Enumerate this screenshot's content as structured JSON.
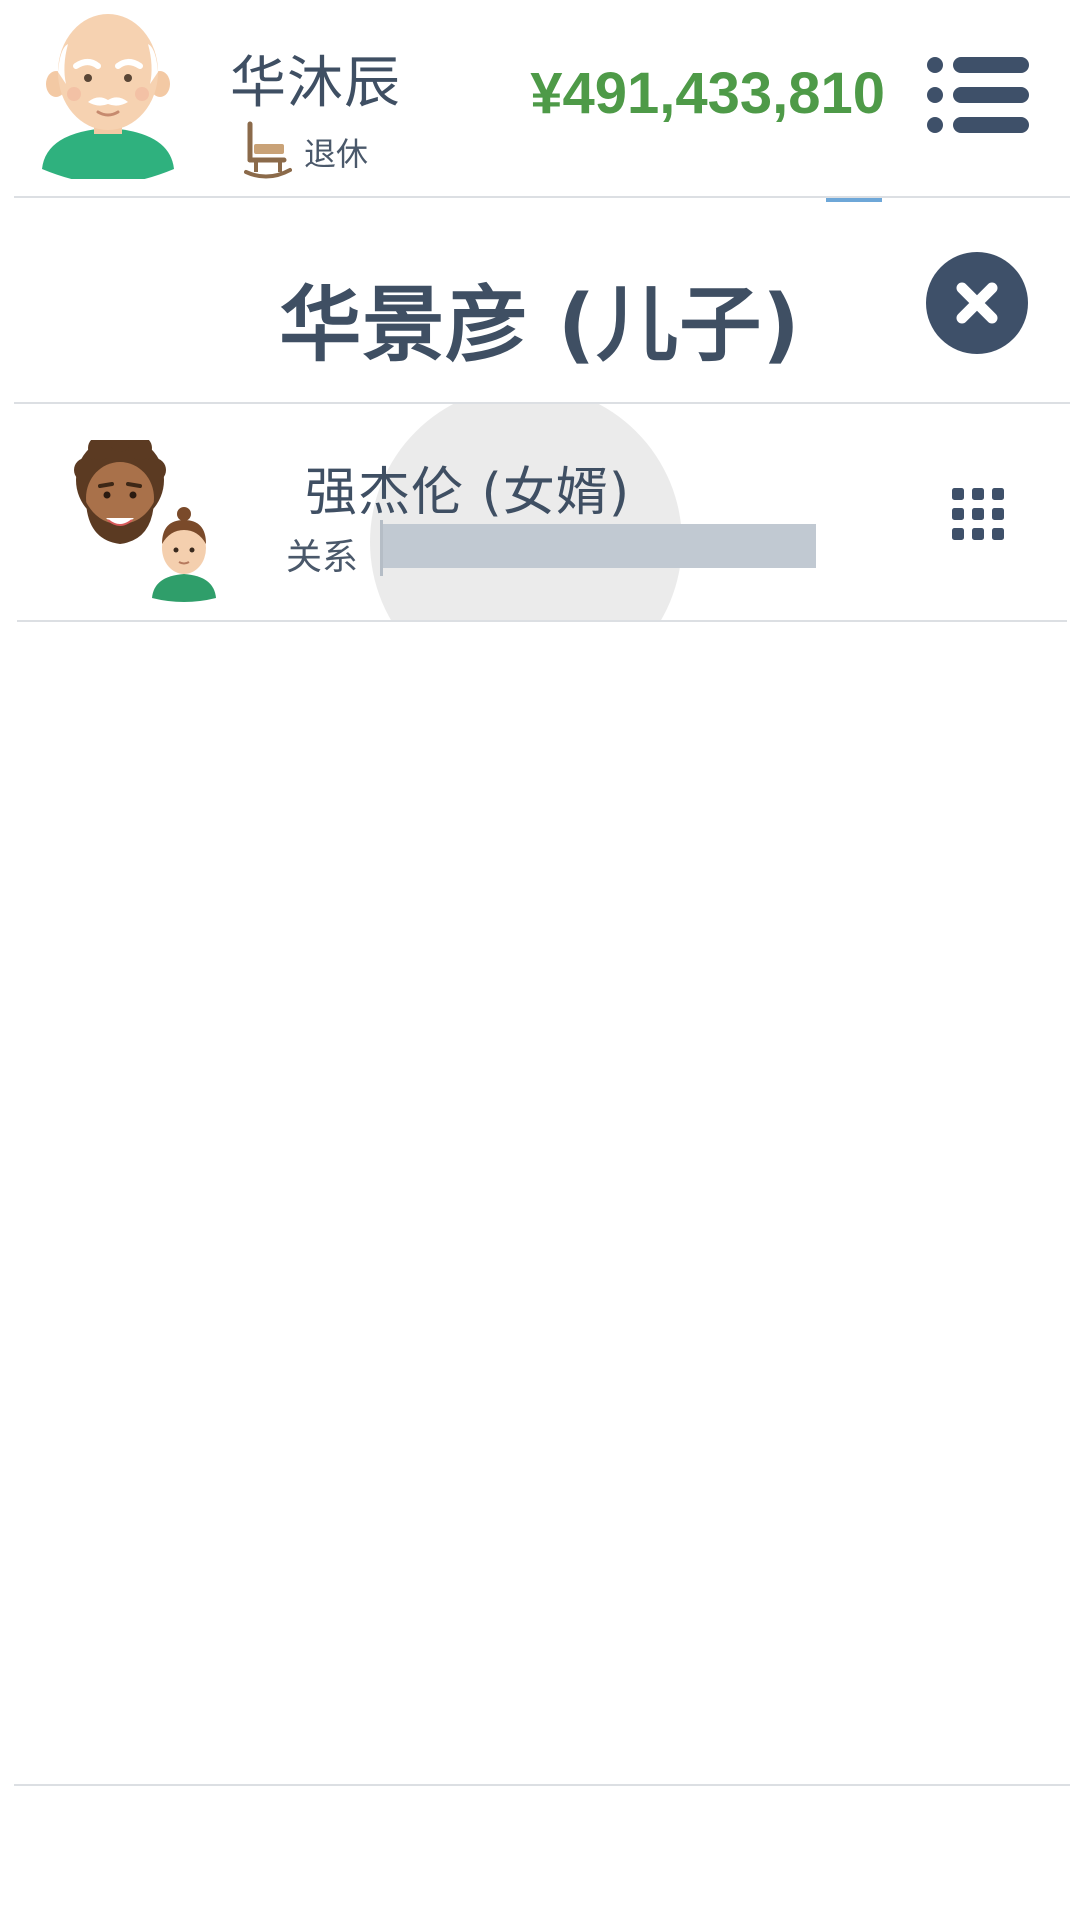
{
  "header": {
    "player_name": "华沐辰",
    "status_label": "退休",
    "money": "¥491,433,810",
    "avatar_icon": "elderly-man-avatar",
    "status_icon": "rocking-chair-icon",
    "menu_icon": "list-menu-icon"
  },
  "panel": {
    "title": "华景彦 (儿子)",
    "close_icon": "close-icon"
  },
  "relation": {
    "member_name": "强杰伦 (女婿)",
    "label": "关系",
    "level": 0,
    "avatar_icon": "bearded-man-avatar",
    "child_avatar_icon": "child-avatar",
    "options_icon": "grid-dots-icon"
  },
  "colors": {
    "money": "#4e9a48",
    "text": "#3f4f63",
    "button": "#3e5069",
    "bar": "#c1c9d2",
    "divider": "#dcdfe3",
    "tab_indicator": "#6ea7d8"
  }
}
